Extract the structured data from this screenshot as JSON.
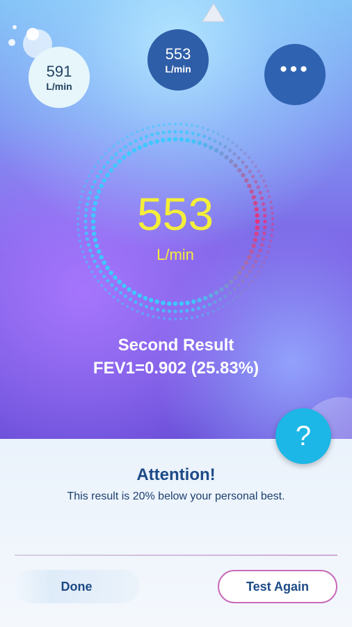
{
  "top_nav": {
    "arrow_icon": "triangle-up-icon"
  },
  "personal_best": {
    "value": "591",
    "unit": "L/min"
  },
  "current_reading": {
    "value": "553",
    "unit": "L/min"
  },
  "more_menu": {
    "label": "•••",
    "icon": "more-dots-icon"
  },
  "gauge": {
    "value": "553",
    "unit": "L/min"
  },
  "result": {
    "title": "Second Result",
    "fev": "FEV1=0.902 (25.83%)"
  },
  "help": {
    "label": "?",
    "icon": "question-icon"
  },
  "attention": {
    "title": "Attention!",
    "message": "This result is 20% below your personal best."
  },
  "actions": {
    "done_label": "Done",
    "test_again_label": "Test Again"
  },
  "colors": {
    "accent_yellow": "#f4ee3a",
    "help_cyan": "#1cb7e6",
    "text_navy": "#1d4a86",
    "ring_blue": "#3ec8ff",
    "ring_pink": "#e8317a"
  }
}
